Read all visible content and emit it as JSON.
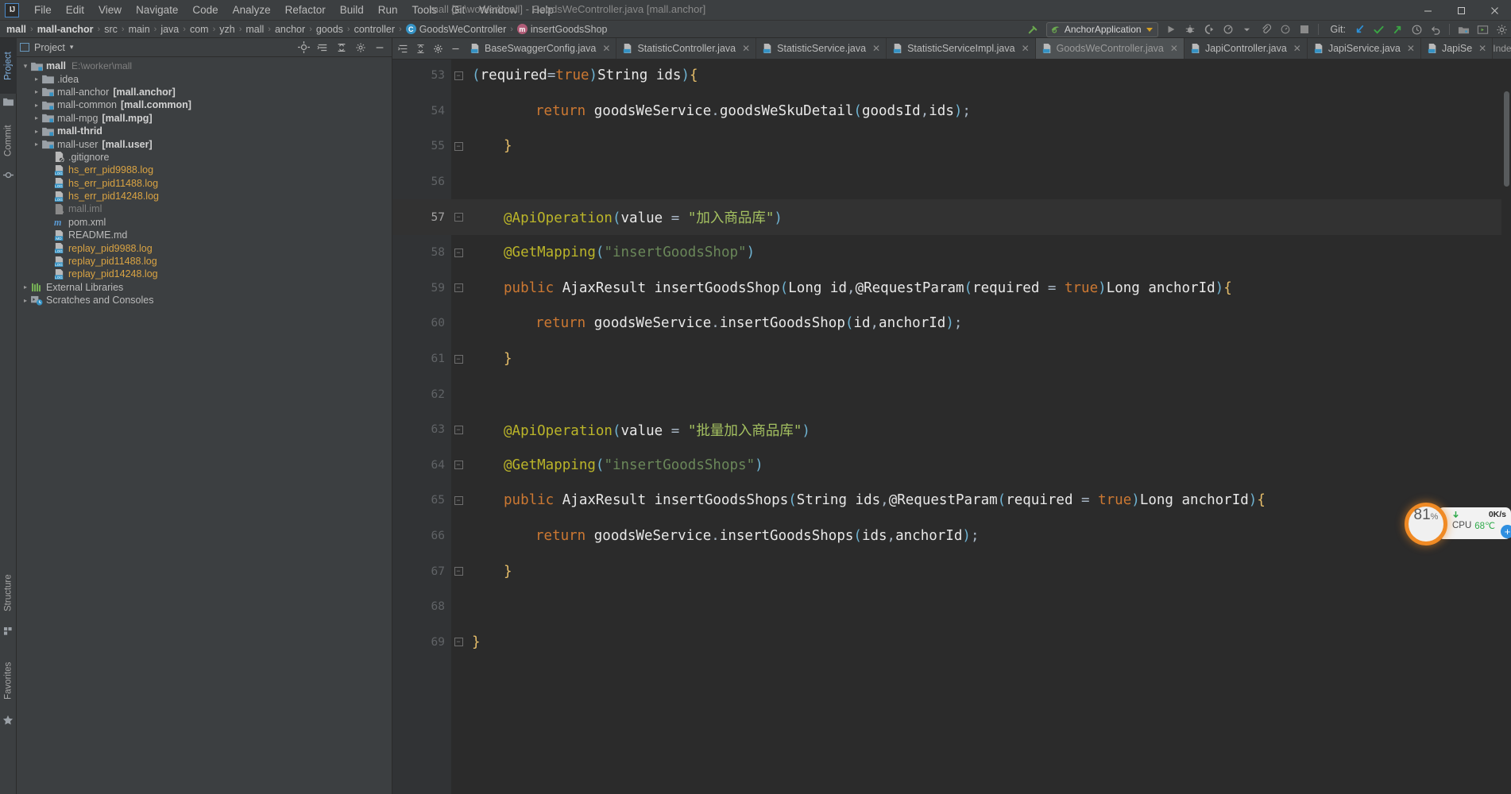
{
  "window": {
    "title": "mall [E:\\worker\\mall] - GoodsWeController.java [mall.anchor]",
    "minimize": "—",
    "maximize": "☐",
    "close": "✕"
  },
  "menu": {
    "items": [
      "File",
      "Edit",
      "View",
      "Navigate",
      "Code",
      "Analyze",
      "Refactor",
      "Build",
      "Run",
      "Tools",
      "Git",
      "Window",
      "Help"
    ]
  },
  "breadcrumb": {
    "items": [
      {
        "label": "mall",
        "bold": true,
        "icon": ""
      },
      {
        "label": "mall-anchor",
        "bold": true,
        "icon": ""
      },
      {
        "label": "src",
        "bold": false,
        "icon": ""
      },
      {
        "label": "main",
        "bold": false,
        "icon": ""
      },
      {
        "label": "java",
        "bold": false,
        "icon": ""
      },
      {
        "label": "com",
        "bold": false,
        "icon": ""
      },
      {
        "label": "yzh",
        "bold": false,
        "icon": ""
      },
      {
        "label": "mall",
        "bold": false,
        "icon": ""
      },
      {
        "label": "anchor",
        "bold": false,
        "icon": ""
      },
      {
        "label": "goods",
        "bold": false,
        "icon": ""
      },
      {
        "label": "controller",
        "bold": false,
        "icon": ""
      },
      {
        "label": "GoodsWeController",
        "bold": false,
        "icon": "class-icon",
        "iconLetter": "C"
      },
      {
        "label": "insertGoodsShop",
        "bold": false,
        "icon": "method-icon",
        "iconLetter": "m"
      }
    ],
    "separator": "›"
  },
  "toolbar": {
    "run_config": "AnchorApplication",
    "git_label": "Git:",
    "icons": [
      "build-hammer-icon",
      "run-icon",
      "debug-icon",
      "run-with-coverage-icon",
      "profiler-icon",
      "attach-icon",
      "stop-icon"
    ],
    "git_icons": [
      "update-project-icon",
      "commit-icon",
      "push-icon",
      "history-icon",
      "rollback-icon"
    ],
    "right_icons": [
      "search-everywhere-icon",
      "settings-icon",
      "project-structure-icon"
    ]
  },
  "left_strip": {
    "top_tabs": [
      {
        "label": "Project",
        "icon": "project-icon",
        "active": true
      },
      {
        "label": "Commit",
        "icon": "commit-icon",
        "active": false
      }
    ],
    "bottom_tabs": [
      {
        "label": "Structure",
        "icon": "structure-icon"
      },
      {
        "label": "Favorites",
        "icon": "star-icon"
      }
    ]
  },
  "project_panel": {
    "title": "Project",
    "dropdown": "▾",
    "actions": [
      "locate-icon",
      "expand-all-icon",
      "collapse-all-icon",
      "settings-icon",
      "hide-icon"
    ],
    "tree": [
      {
        "indent": 0,
        "arrow": "open",
        "icon": "module-folder",
        "name": "mall",
        "bold": true,
        "path": "E:\\worker\\mall"
      },
      {
        "indent": 1,
        "arrow": "closed",
        "icon": "folder",
        "name": ".idea",
        "bold": false
      },
      {
        "indent": 1,
        "arrow": "closed",
        "icon": "module-folder",
        "name": "mall-anchor",
        "bold": false,
        "bracket": "[mall.anchor]"
      },
      {
        "indent": 1,
        "arrow": "closed",
        "icon": "module-folder",
        "name": "mall-common",
        "bold": false,
        "bracket": "[mall.common]"
      },
      {
        "indent": 1,
        "arrow": "closed",
        "icon": "module-folder",
        "name": "mall-mpg",
        "bold": false,
        "bracket": "[mall.mpg]"
      },
      {
        "indent": 1,
        "arrow": "closed",
        "icon": "module-folder",
        "name": "mall-thrid",
        "bold": true
      },
      {
        "indent": 1,
        "arrow": "closed",
        "icon": "module-folder",
        "name": "mall-user",
        "bold": false,
        "bracket": "[mall.user]"
      },
      {
        "indent": 2,
        "arrow": "none",
        "icon": "gitignore-file",
        "name": ".gitignore",
        "bold": false
      },
      {
        "indent": 2,
        "arrow": "none",
        "icon": "log-file",
        "name": "hs_err_pid9988.log",
        "kind": "log"
      },
      {
        "indent": 2,
        "arrow": "none",
        "icon": "log-file",
        "name": "hs_err_pid11488.log",
        "kind": "log"
      },
      {
        "indent": 2,
        "arrow": "none",
        "icon": "log-file",
        "name": "hs_err_pid14248.log",
        "kind": "log"
      },
      {
        "indent": 2,
        "arrow": "none",
        "icon": "iml-file",
        "name": "mall.iml",
        "kind": "dim"
      },
      {
        "indent": 2,
        "arrow": "none",
        "icon": "maven-file",
        "name": "pom.xml"
      },
      {
        "indent": 2,
        "arrow": "none",
        "icon": "md-file",
        "name": "README.md"
      },
      {
        "indent": 2,
        "arrow": "none",
        "icon": "log-file",
        "name": "replay_pid9988.log",
        "kind": "log"
      },
      {
        "indent": 2,
        "arrow": "none",
        "icon": "log-file",
        "name": "replay_pid11488.log",
        "kind": "log"
      },
      {
        "indent": 2,
        "arrow": "none",
        "icon": "log-file",
        "name": "replay_pid14248.log",
        "kind": "log"
      },
      {
        "indent": 0,
        "arrow": "closed",
        "icon": "library-icon",
        "name": "External Libraries"
      },
      {
        "indent": 0,
        "arrow": "closed",
        "icon": "scratch-icon",
        "name": "Scratches and Consoles"
      }
    ]
  },
  "editor": {
    "tabs": [
      {
        "label": "BaseSwaggerConfig.java",
        "active": false
      },
      {
        "label": "StatisticController.java",
        "active": false
      },
      {
        "label": "StatisticService.java",
        "active": false
      },
      {
        "label": "StatisticServiceImpl.java",
        "active": false
      },
      {
        "label": "GoodsWeController.java",
        "active": true
      },
      {
        "label": "JapiController.java",
        "active": false
      },
      {
        "label": "JapiService.java",
        "active": false
      },
      {
        "label": "JapiSe",
        "active": false
      }
    ],
    "tab_close": "✕",
    "status_right": "Indexing...",
    "current_line": 57,
    "lines": [
      {
        "num": 53,
        "fold": "end",
        "tokens": [
          {
            "t": "(",
            "c": "pn"
          },
          {
            "t": "required",
            "c": "wh"
          },
          {
            "t": "=",
            "c": "op"
          },
          {
            "t": "true",
            "c": "k"
          },
          {
            "t": ")",
            "c": "pn"
          },
          {
            "t": "String ids",
            "c": "wh"
          },
          {
            "t": ")",
            "c": "pn"
          },
          {
            "t": "{",
            "c": "br"
          }
        ]
      },
      {
        "num": 54,
        "fold": "",
        "indent": 2,
        "tokens": [
          {
            "t": "return",
            "c": "k"
          },
          {
            "t": " goodsWeService",
            "c": "wh"
          },
          {
            "t": ".",
            "c": "op"
          },
          {
            "t": "goodsWeSkuDetail",
            "c": "wh"
          },
          {
            "t": "(",
            "c": "pn"
          },
          {
            "t": "goodsId",
            "c": "wh"
          },
          {
            "t": ",",
            "c": "op"
          },
          {
            "t": "ids",
            "c": "wh"
          },
          {
            "t": ")",
            "c": "pn"
          },
          {
            "t": ";",
            "c": "op"
          }
        ]
      },
      {
        "num": 55,
        "fold": "end",
        "indent": 1,
        "tokens": [
          {
            "t": "}",
            "c": "br"
          }
        ]
      },
      {
        "num": 56,
        "fold": "",
        "tokens": []
      },
      {
        "num": 57,
        "fold": "collapse",
        "indent": 1,
        "tokens": [
          {
            "t": "@ApiOperation",
            "c": "an"
          },
          {
            "t": "(",
            "c": "pn"
          },
          {
            "t": "value",
            "c": "wh"
          },
          {
            "t": " = ",
            "c": "op"
          },
          {
            "t": "\"加入商品库\"",
            "c": "stc"
          },
          {
            "t": ")",
            "c": "pn"
          }
        ]
      },
      {
        "num": 58,
        "fold": "start",
        "indent": 1,
        "tokens": [
          {
            "t": "@GetMapping",
            "c": "an"
          },
          {
            "t": "(",
            "c": "pn"
          },
          {
            "t": "\"insertGoodsShop\"",
            "c": "st"
          },
          {
            "t": ")",
            "c": "pn"
          }
        ]
      },
      {
        "num": 59,
        "fold": "start",
        "indent": 1,
        "tokens": [
          {
            "t": "public",
            "c": "k"
          },
          {
            "t": " AjaxResult insertGoodsShop",
            "c": "wh"
          },
          {
            "t": "(",
            "c": "pn"
          },
          {
            "t": "Long id",
            "c": "wh"
          },
          {
            "t": ",",
            "c": "op"
          },
          {
            "t": "@RequestParam",
            "c": "wh"
          },
          {
            "t": "(",
            "c": "pn"
          },
          {
            "t": "required",
            "c": "wh"
          },
          {
            "t": " = ",
            "c": "op"
          },
          {
            "t": "true",
            "c": "k"
          },
          {
            "t": ")",
            "c": "pn"
          },
          {
            "t": "Long anchorId",
            "c": "wh"
          },
          {
            "t": ")",
            "c": "pn"
          },
          {
            "t": "{",
            "c": "br"
          }
        ]
      },
      {
        "num": 60,
        "fold": "",
        "indent": 2,
        "tokens": [
          {
            "t": "return",
            "c": "k"
          },
          {
            "t": " goodsWeService",
            "c": "wh"
          },
          {
            "t": ".",
            "c": "op"
          },
          {
            "t": "insertGoodsShop",
            "c": "wh"
          },
          {
            "t": "(",
            "c": "pn"
          },
          {
            "t": "id",
            "c": "wh"
          },
          {
            "t": ",",
            "c": "op"
          },
          {
            "t": "anchorId",
            "c": "wh"
          },
          {
            "t": ")",
            "c": "pn"
          },
          {
            "t": ";",
            "c": "op"
          }
        ]
      },
      {
        "num": 61,
        "fold": "end",
        "indent": 1,
        "tokens": [
          {
            "t": "}",
            "c": "br"
          }
        ]
      },
      {
        "num": 62,
        "fold": "",
        "tokens": []
      },
      {
        "num": 63,
        "fold": "collapse",
        "indent": 1,
        "tokens": [
          {
            "t": "@ApiOperation",
            "c": "an"
          },
          {
            "t": "(",
            "c": "pn"
          },
          {
            "t": "value",
            "c": "wh"
          },
          {
            "t": " = ",
            "c": "op"
          },
          {
            "t": "\"批量加入商品库\"",
            "c": "stc"
          },
          {
            "t": ")",
            "c": "pn"
          }
        ]
      },
      {
        "num": 64,
        "fold": "start",
        "indent": 1,
        "tokens": [
          {
            "t": "@GetMapping",
            "c": "an"
          },
          {
            "t": "(",
            "c": "pn"
          },
          {
            "t": "\"insertGoodsShops\"",
            "c": "st"
          },
          {
            "t": ")",
            "c": "pn"
          }
        ]
      },
      {
        "num": 65,
        "fold": "start",
        "indent": 1,
        "tokens": [
          {
            "t": "public",
            "c": "k"
          },
          {
            "t": " AjaxResult insertGoodsShops",
            "c": "wh"
          },
          {
            "t": "(",
            "c": "pn"
          },
          {
            "t": "String ids",
            "c": "wh"
          },
          {
            "t": ",",
            "c": "op"
          },
          {
            "t": "@RequestParam",
            "c": "wh"
          },
          {
            "t": "(",
            "c": "pn"
          },
          {
            "t": "required",
            "c": "wh"
          },
          {
            "t": " = ",
            "c": "op"
          },
          {
            "t": "true",
            "c": "k"
          },
          {
            "t": ")",
            "c": "pn"
          },
          {
            "t": "Long anchorId",
            "c": "wh"
          },
          {
            "t": ")",
            "c": "pn"
          },
          {
            "t": "{",
            "c": "br"
          }
        ]
      },
      {
        "num": 66,
        "fold": "",
        "indent": 2,
        "tokens": [
          {
            "t": "return",
            "c": "k"
          },
          {
            "t": " goodsWeService",
            "c": "wh"
          },
          {
            "t": ".",
            "c": "op"
          },
          {
            "t": "insertGoodsShops",
            "c": "wh"
          },
          {
            "t": "(",
            "c": "pn"
          },
          {
            "t": "ids",
            "c": "wh"
          },
          {
            "t": ",",
            "c": "op"
          },
          {
            "t": "anchorId",
            "c": "wh"
          },
          {
            "t": ")",
            "c": "pn"
          },
          {
            "t": ";",
            "c": "op"
          }
        ]
      },
      {
        "num": 67,
        "fold": "end",
        "indent": 1,
        "tokens": [
          {
            "t": "}",
            "c": "br"
          }
        ]
      },
      {
        "num": 68,
        "fold": "",
        "tokens": []
      },
      {
        "num": 69,
        "fold": "end",
        "indent": 0,
        "tokens": [
          {
            "t": "}",
            "c": "br"
          }
        ]
      }
    ]
  },
  "cpu_widget": {
    "percent": "81",
    "percent_symbol": "%",
    "net_speed": "0K/s",
    "cpu_label": "CPU",
    "cpu_temp": "68℃",
    "plus": "+",
    "accent_color": "#f08a24",
    "green_color": "#2eaa4a",
    "blue_color": "#2f8fe0"
  }
}
